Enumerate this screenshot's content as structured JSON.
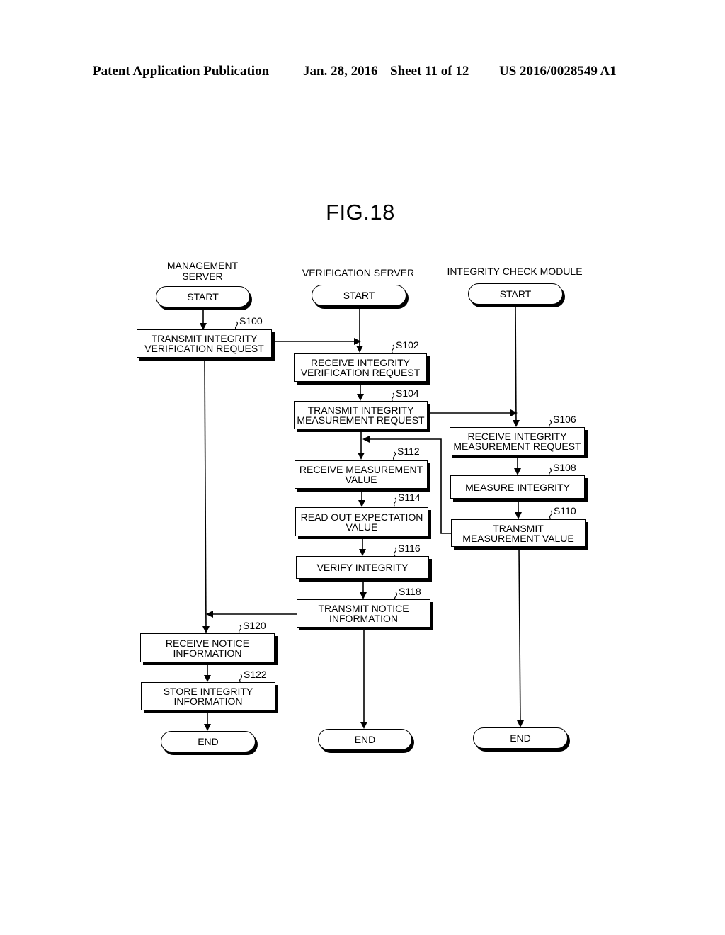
{
  "header": {
    "publication": "Patent Application Publication",
    "date": "Jan. 28, 2016",
    "sheet": "Sheet 11 of 12",
    "number": "US 2016/0028549 A1"
  },
  "figure": {
    "title": "FIG.18",
    "lanes": [
      {
        "id": "management",
        "label_line1": "MANAGEMENT",
        "label_line2": "SERVER"
      },
      {
        "id": "verification",
        "label": "VERIFICATION SERVER"
      },
      {
        "id": "module",
        "label": "INTEGRITY CHECK MODULE"
      }
    ],
    "terminals": {
      "start": "START",
      "end": "END"
    },
    "steps": [
      {
        "id": "S100",
        "lane": "management",
        "text": "TRANSMIT INTEGRITY\nVERIFICATION REQUEST"
      },
      {
        "id": "S102",
        "lane": "verification",
        "text": "RECEIVE INTEGRITY\nVERIFICATION REQUEST"
      },
      {
        "id": "S104",
        "lane": "verification",
        "text": "TRANSMIT INTEGRITY\nMEASUREMENT REQUEST"
      },
      {
        "id": "S106",
        "lane": "module",
        "text": "RECEIVE INTEGRITY\nMEASUREMENT REQUEST"
      },
      {
        "id": "S108",
        "lane": "module",
        "text": "MEASURE INTEGRITY"
      },
      {
        "id": "S110",
        "lane": "module",
        "text": "TRANSMIT\nMEASUREMENT VALUE"
      },
      {
        "id": "S112",
        "lane": "verification",
        "text": "RECEIVE MEASUREMENT\nVALUE"
      },
      {
        "id": "S114",
        "lane": "verification",
        "text": "READ OUT EXPECTATION\nVALUE"
      },
      {
        "id": "S116",
        "lane": "verification",
        "text": "VERIFY INTEGRITY"
      },
      {
        "id": "S118",
        "lane": "verification",
        "text": "TRANSMIT NOTICE\nINFORMATION"
      },
      {
        "id": "S120",
        "lane": "management",
        "text": "RECEIVE NOTICE\nINFORMATION"
      },
      {
        "id": "S122",
        "lane": "management",
        "text": "STORE INTEGRITY\nINFORMATION"
      }
    ],
    "flows": [
      {
        "from": "START(management)",
        "to": "S100"
      },
      {
        "from": "S100",
        "to": "S102"
      },
      {
        "from": "START(verification)",
        "to": "S102"
      },
      {
        "from": "S102",
        "to": "S104"
      },
      {
        "from": "S104",
        "to": "S106"
      },
      {
        "from": "START(module)",
        "to": "S106"
      },
      {
        "from": "S106",
        "to": "S108"
      },
      {
        "from": "S108",
        "to": "S110"
      },
      {
        "from": "S110",
        "to": "S112"
      },
      {
        "from": "S104",
        "to": "S112"
      },
      {
        "from": "S112",
        "to": "S114"
      },
      {
        "from": "S114",
        "to": "S116"
      },
      {
        "from": "S116",
        "to": "S118"
      },
      {
        "from": "S118",
        "to": "S120"
      },
      {
        "from": "S100",
        "to": "S120"
      },
      {
        "from": "S120",
        "to": "S122"
      },
      {
        "from": "S122",
        "to": "END(management)"
      },
      {
        "from": "S118",
        "to": "END(verification)"
      },
      {
        "from": "S110",
        "to": "END(module)"
      }
    ]
  }
}
